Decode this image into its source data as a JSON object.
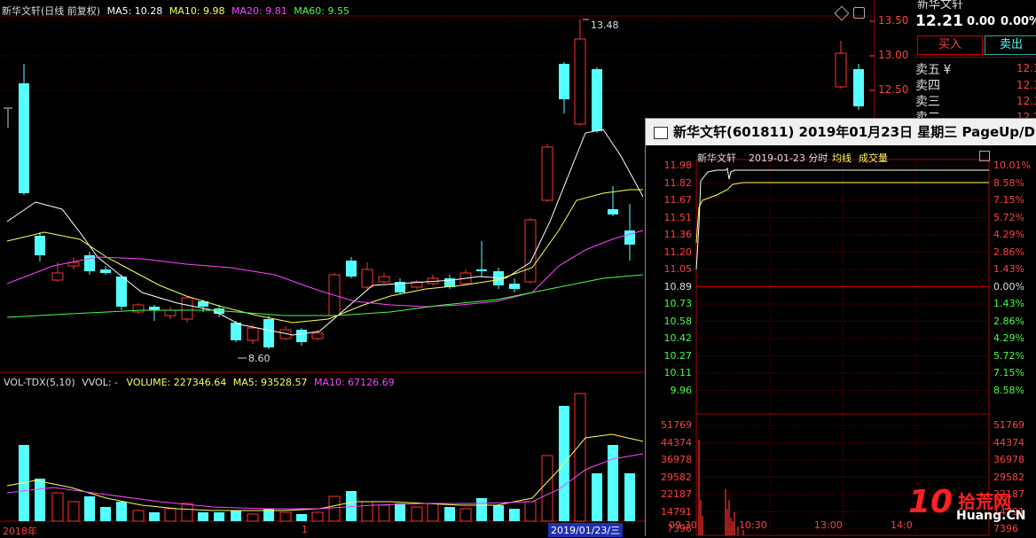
{
  "main_chart": {
    "title": "新华文轩(日线 前复权)",
    "ma": [
      {
        "label": "MA5: 10.28",
        "color": "#ffffff"
      },
      {
        "label": "MA10: 9.98",
        "color": "#ffff55"
      },
      {
        "label": "MA20: 9.81",
        "color": "#ff44ff"
      },
      {
        "label": "MA60: 9.55",
        "color": "#44ff44"
      }
    ],
    "high_label": "13.48",
    "low_label": "8.60",
    "price_axis": [
      "13.50",
      "13.00",
      "12.50"
    ]
  },
  "volume_chart": {
    "indicator": "VOL-TDX(5,10)",
    "vvol": "VVOL: -",
    "volume": "VOLUME: 227346.64",
    "ma5": "MA5: 93528.57",
    "ma10": "MA10: 67126.69"
  },
  "date_axis": {
    "left": "2018年",
    "mid": "1",
    "highlight": "2019/01/23/三"
  },
  "quote_panel": {
    "stock_name": "新华文轩",
    "price": "12.21",
    "change": "0.00",
    "pct": "0.00%",
    "buy_label": "买入",
    "sell_label": "卖出",
    "levels": [
      {
        "label": "卖五",
        "icon": "¥",
        "price": "12.3"
      },
      {
        "label": "卖四",
        "price": "12.3"
      },
      {
        "label": "卖三",
        "price": "12.3"
      },
      {
        "label": "卖二",
        "price": "12.2"
      }
    ]
  },
  "popup": {
    "title": "新华文轩(601811) 2019年01月23日 星期三 PageUp/D",
    "sub_name": "新华文轩",
    "sub_date": "2019-01-23 分时",
    "sub_avg": "均线",
    "sub_vol": "成交量",
    "price_labels": [
      "11.98",
      "11.82",
      "11.67",
      "11.51",
      "11.36",
      "11.20",
      "11.05",
      "10.89",
      "10.73",
      "10.58",
      "10.42",
      "10.27",
      "10.11",
      "9.96"
    ],
    "pct_labels": [
      "10.01%",
      "8.58%",
      "7.15%",
      "5.72%",
      "4.29%",
      "2.86%",
      "1.43%",
      "0.00%",
      "1.43%",
      "2.86%",
      "4.29%",
      "5.72%",
      "7.15%",
      "8.58%"
    ],
    "vol_labels": [
      "51769",
      "44374",
      "36978",
      "29582",
      "22187",
      "14791",
      "7396"
    ],
    "time_labels": [
      "09:30",
      "10:30",
      "13:00",
      "14:0"
    ]
  },
  "watermark": {
    "number": "10",
    "brand": "拾荒网",
    "domain": "Huang.CN"
  },
  "colors": {
    "up": "#ff3232",
    "down": "#54ffff",
    "grid": "#800000"
  }
}
